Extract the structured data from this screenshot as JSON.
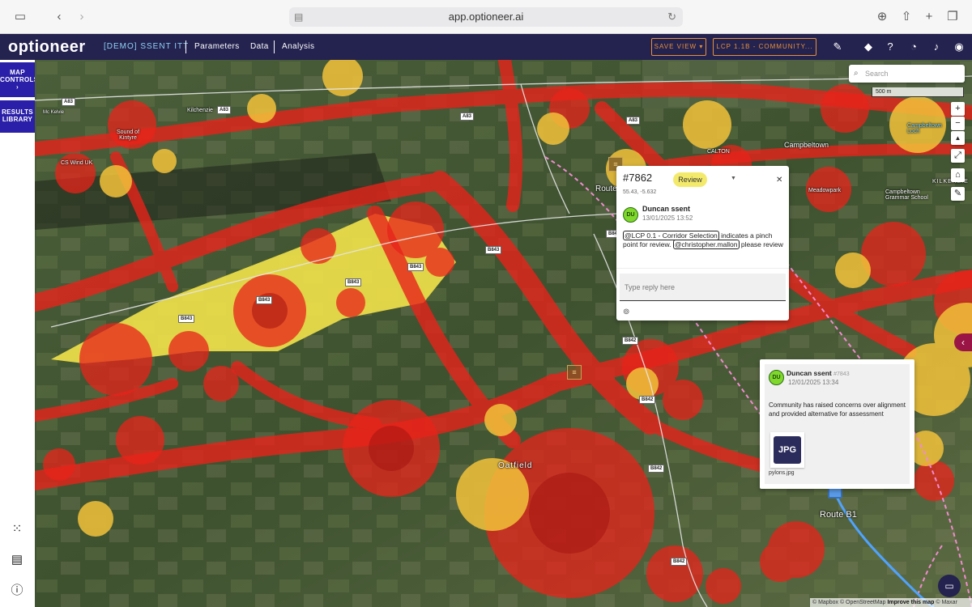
{
  "browser": {
    "url": "app.optioneer.ai"
  },
  "header": {
    "logo": "optioneer",
    "project": "[DEMO] SSENT ITT",
    "nav": [
      "Parameters",
      "Data",
      "Analysis"
    ],
    "save_view": "SAVE VIEW ▾",
    "lcp_select": "LCP 1.1B - COMMUNITY... ▾"
  },
  "sidebar": {
    "map_controls": "MAP CONTROLS",
    "map_controls_arrow": "›",
    "results_library": "RESULTS LIBRARY"
  },
  "map": {
    "search_placeholder": "Search",
    "scale": "500 m",
    "places": [
      "Kilchenzie",
      "Sound of Kintyre",
      "CS Wind UK",
      "Campbeltown",
      "CALTON",
      "Campbeltown Loch",
      "Meadowpark",
      "Campbeltown Grammar School",
      "KILKENZIE",
      "Route",
      "Oatfield",
      "Mc Kelvie"
    ],
    "roads": [
      "A83",
      "A83",
      "A83",
      "A83",
      "B843",
      "B843",
      "B843",
      "B843",
      "B842",
      "B842",
      "B842",
      "B842",
      "B842",
      "B843"
    ],
    "route_label": "Route B1",
    "attribution_prefix": "© Mapbox © OpenStreetMap",
    "attribution_link": "Improve this map",
    "attribution_suffix": "© Maxar"
  },
  "comment_popup": {
    "id": "#7862",
    "coords": "55.43, -5.632",
    "status": "Review",
    "avatar": "DU",
    "author": "Duncan ssent",
    "date": "13/01/2025 13:52",
    "mention1": "@LCP 0.1 - Corridor Selection",
    "text1": " indicates a pinch point for review. ",
    "mention2": "@christopher.mallon",
    "text2": " please review",
    "reply_placeholder": "Type reply here"
  },
  "comment_card": {
    "avatar": "DU",
    "author": "Duncan ssent",
    "id": "#7843",
    "date": "12/01/2025 13:34",
    "body": "Community has raised concerns over alignment and provided alternative for assessment",
    "file_type": "JPG",
    "file_name": "pylons.jpg"
  },
  "colors": {
    "header_bg": "#24224f",
    "sidebar_btn": "#2a1fa8",
    "accent_orange": "#e8913a",
    "constraint_red": "#e8231a",
    "constraint_yellow": "#f2e24a",
    "status_yellow": "#f3ea6b",
    "avatar_green": "#7fd82b"
  }
}
